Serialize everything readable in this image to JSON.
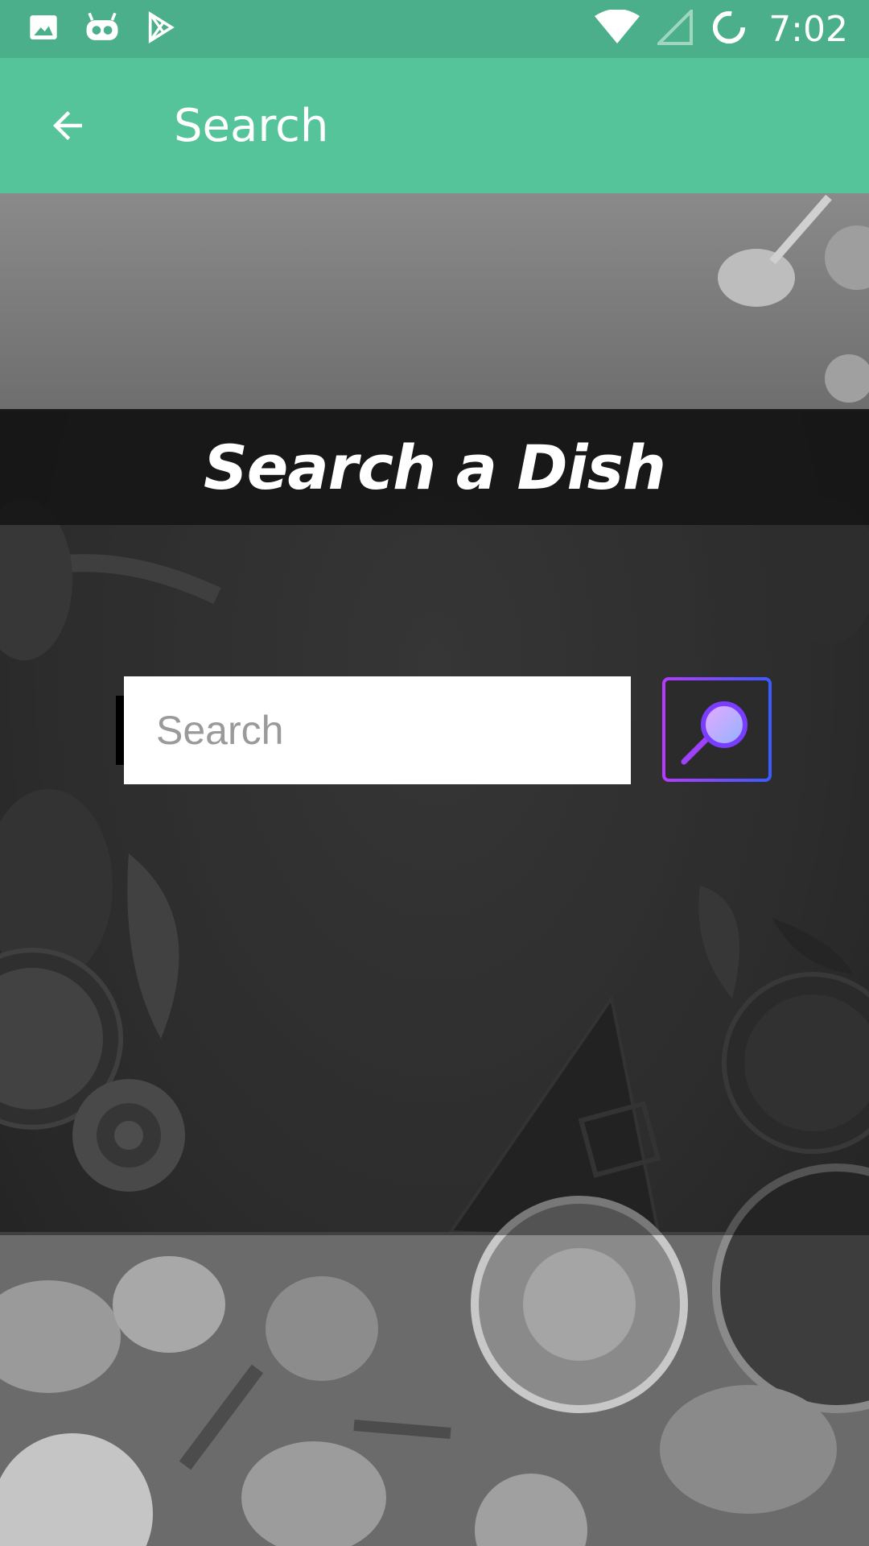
{
  "status_bar": {
    "time": "7:02",
    "left_icons": [
      "image-icon",
      "android-robot-icon",
      "play-store-icon"
    ],
    "right_icons": [
      "wifi-icon",
      "signal-icon",
      "sync-icon"
    ]
  },
  "app_bar": {
    "title": "Search",
    "back_icon": "arrow-back-icon"
  },
  "main": {
    "heading": "Search a Dish",
    "search": {
      "placeholder": "Search",
      "value": ""
    },
    "search_button_icon": "magnifier-icon"
  },
  "colors": {
    "status_bar": "#4caf8c",
    "app_bar": "#55c49a",
    "accent_purple": "#b53bff",
    "accent_blue": "#3b5bff"
  }
}
